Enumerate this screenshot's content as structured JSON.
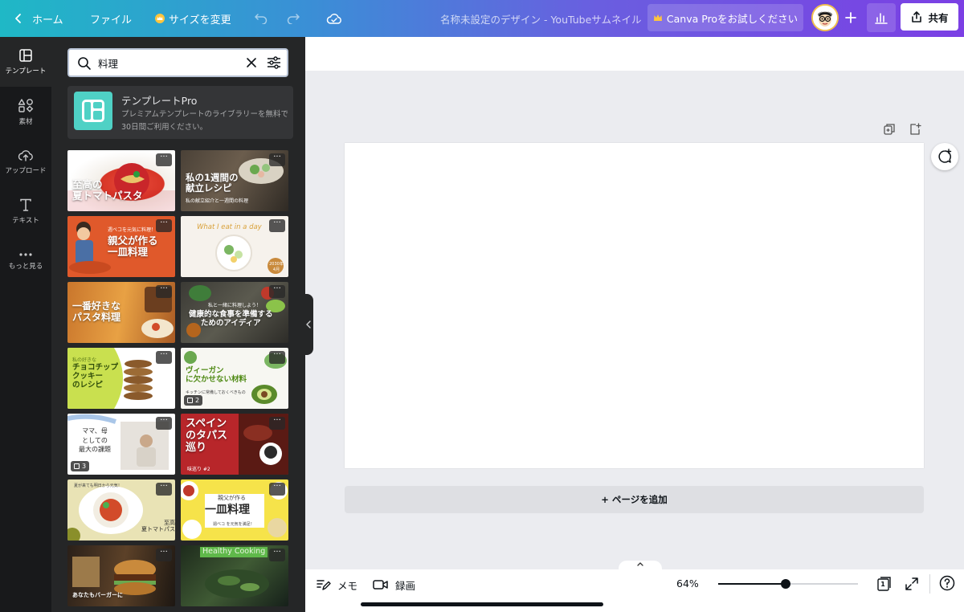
{
  "topbar": {
    "home_label": "ホーム",
    "file_label": "ファイル",
    "resize_label": "サイズを変更",
    "document_title": "名称未設定のデザイン - YouTubeサムネイル",
    "pro_label": "Canva Proをお試しください",
    "share_label": "共有"
  },
  "rail": {
    "items": [
      {
        "label": "テンプレート",
        "icon": "template-icon"
      },
      {
        "label": "素材",
        "icon": "elements-icon"
      },
      {
        "label": "アップロード",
        "icon": "upload-icon"
      },
      {
        "label": "テキスト",
        "icon": "text-icon"
      },
      {
        "label": "もっと見る",
        "icon": "more-icon"
      }
    ]
  },
  "panel": {
    "search_value": "料理",
    "promo": {
      "title": "テンプレートPro",
      "description": "プレミアムテンプレートのライブラリーを無料で30日間ご利用ください。"
    },
    "templates": [
      {
        "title": "至高の\n夏トマトパスタ"
      },
      {
        "title": "私の1週間の\n献立レシピ",
        "sub": "私の献立紹介と一週間の料理"
      },
      {
        "title": "親父が作る\n一皿料理",
        "top": "週ベコを元気に料理！"
      },
      {
        "title": "What I eat in a day",
        "tag": "2030年\n4月"
      },
      {
        "title": "一番好きな\nパスタ料理"
      },
      {
        "title": "健康的な食事を準備する\nためのアイディア",
        "top": "私と一緒に料理しよう！"
      },
      {
        "title": "チョコチップ\nクッキー\nのレシピ",
        "top": "私の好きな"
      },
      {
        "title": "ヴィーガン\nに欠かせない材料",
        "sub": "キッチンに常備しておくべきもの",
        "badge": "2"
      },
      {
        "title": "ママ、母\nとしての\n最大の課題",
        "badge": "3"
      },
      {
        "title": "スペイン\nのタパス\n巡り",
        "sub": "味巡り #2"
      },
      {
        "title": "至高の\n夏トマトパスタ",
        "top": "夏が来ても明日から元気！"
      },
      {
        "title": "一皿料理",
        "top": "親父が作る",
        "sub": "週ベコ を元気を満足！"
      },
      {
        "title": "あなたもバーガーに"
      },
      {
        "title": "Healthy Cooking"
      }
    ],
    "more_glyph": "···"
  },
  "canvas": {
    "add_page_label": "+ ページを追加"
  },
  "bottombar": {
    "notes_label": "メモ",
    "record_label": "録画",
    "zoom_label": "64%",
    "zoom_fraction": 0.48,
    "page_count": "1"
  },
  "colors": {
    "accent_teal": "#1fb8c6",
    "accent_purple": "#7b3fe4",
    "rail_bg": "#18191b",
    "panel_bg": "#252627",
    "crown": "#ffc53d"
  }
}
